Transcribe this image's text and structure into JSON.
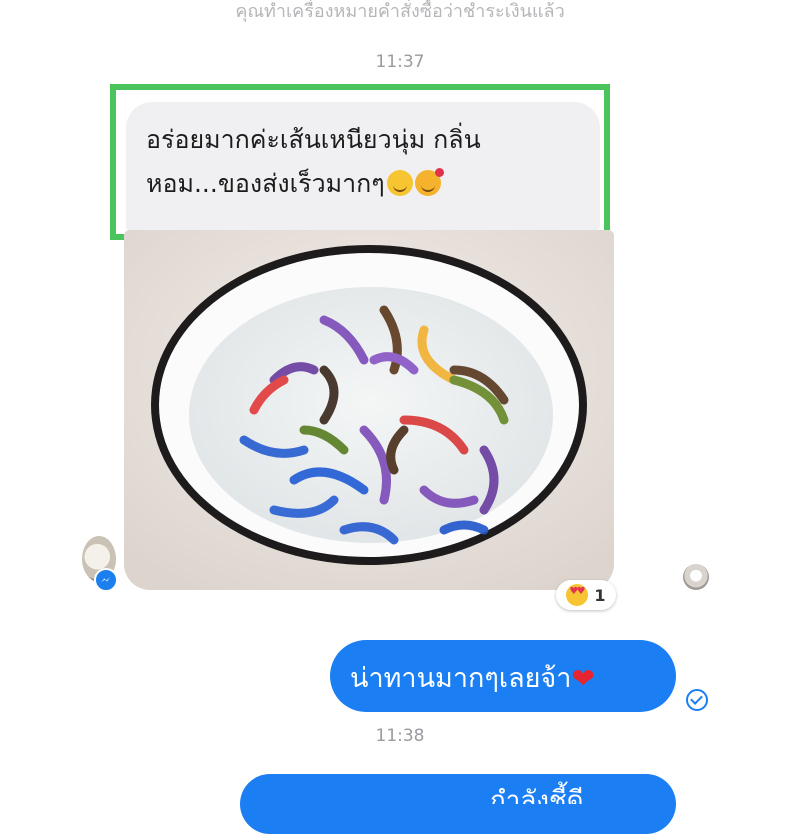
{
  "chat": {
    "system_message": "คุณทำเครื่องหมายคำสั่งซื้อว่าชำระเงินแล้ว",
    "timestamp_1": "11:37",
    "incoming_message": "อร่อยมากค่ะเส้นเหนียวนุ่ม กลิ่นหอม...ของส่งเร็วมากๆ",
    "incoming_emojis": [
      "yum-emoji",
      "smiling-face-with-hearts-emoji"
    ],
    "photo_reaction": {
      "emoji": "heart-eyes-emoji",
      "count": "1"
    },
    "outgoing_message": "น่าทานมากๆเลยจ้า",
    "outgoing_emoji": "red-heart-emoji",
    "timestamp_2": "11:38",
    "outgoing_message_2_partial": "กำลังชี้ดี"
  },
  "colors": {
    "highlight_frame": "#4cc35c",
    "outgoing_bubble": "#1b7ff3",
    "incoming_bubble": "#f0f0f2",
    "messenger_badge": "#1c7ff0"
  }
}
